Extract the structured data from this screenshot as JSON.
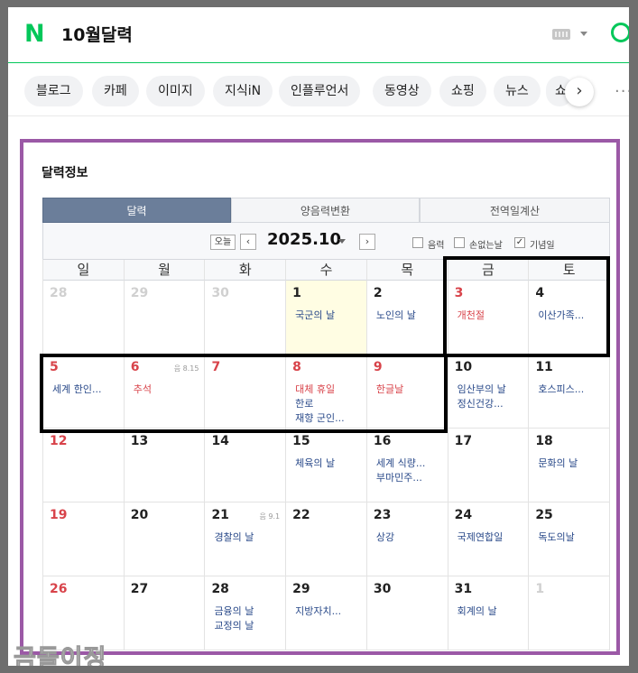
{
  "header": {
    "query": "10월달력",
    "logo": "N"
  },
  "tabs": [
    "블로그",
    "카페",
    "이미지",
    "지식iN",
    "인플루언서",
    "동영상",
    "쇼핑",
    "뉴스",
    "쇼"
  ],
  "section": {
    "title": "달력정보"
  },
  "segments": [
    "달력",
    "양음력변환",
    "전역일계산"
  ],
  "nav": {
    "today": "오늘",
    "prev": "‹",
    "next": "›",
    "year_month": "2025.10"
  },
  "options": [
    {
      "label": "음력",
      "checked": false
    },
    {
      "label": "손없는날",
      "checked": false
    },
    {
      "label": "기념일",
      "checked": true
    }
  ],
  "weekdays": [
    "일",
    "월",
    "화",
    "수",
    "목",
    "금",
    "토"
  ],
  "weeks": [
    [
      {
        "day": "28",
        "style": "dim",
        "events": []
      },
      {
        "day": "29",
        "style": "dim",
        "events": []
      },
      {
        "day": "30",
        "style": "dim",
        "events": []
      },
      {
        "day": "1",
        "style": "normal",
        "today": true,
        "events": [
          {
            "text": "국군의 날",
            "red": false
          }
        ]
      },
      {
        "day": "2",
        "style": "normal",
        "events": [
          {
            "text": "노인의 날",
            "red": false
          }
        ]
      },
      {
        "day": "3",
        "style": "red",
        "events": [
          {
            "text": "개천절",
            "red": true
          }
        ]
      },
      {
        "day": "4",
        "style": "normal",
        "events": [
          {
            "text": "이산가족...",
            "red": false
          }
        ]
      }
    ],
    [
      {
        "day": "5",
        "style": "red",
        "events": [
          {
            "text": "세계 한인...",
            "red": false
          }
        ]
      },
      {
        "day": "6",
        "style": "red",
        "lunar": "음 8.15",
        "events": [
          {
            "text": "추석",
            "red": true
          }
        ]
      },
      {
        "day": "7",
        "style": "red",
        "events": []
      },
      {
        "day": "8",
        "style": "red",
        "events": [
          {
            "text": "대체 휴일",
            "red": true
          },
          {
            "text": "한로",
            "red": false
          },
          {
            "text": "재향 군인...",
            "red": false
          }
        ]
      },
      {
        "day": "9",
        "style": "red",
        "events": [
          {
            "text": "한글날",
            "red": true
          }
        ]
      },
      {
        "day": "10",
        "style": "normal",
        "events": [
          {
            "text": "임산부의 날",
            "red": false
          },
          {
            "text": "정신건강...",
            "red": false
          }
        ]
      },
      {
        "day": "11",
        "style": "normal",
        "events": [
          {
            "text": "호스피스...",
            "red": false
          }
        ]
      }
    ],
    [
      {
        "day": "12",
        "style": "red",
        "events": []
      },
      {
        "day": "13",
        "style": "normal",
        "events": []
      },
      {
        "day": "14",
        "style": "normal",
        "events": []
      },
      {
        "day": "15",
        "style": "normal",
        "events": [
          {
            "text": "체육의 날",
            "red": false
          }
        ]
      },
      {
        "day": "16",
        "style": "normal",
        "events": [
          {
            "text": "세계 식량...",
            "red": false
          },
          {
            "text": "부마민주...",
            "red": false
          }
        ]
      },
      {
        "day": "17",
        "style": "normal",
        "events": []
      },
      {
        "day": "18",
        "style": "normal",
        "events": [
          {
            "text": "문화의 날",
            "red": false
          }
        ]
      }
    ],
    [
      {
        "day": "19",
        "style": "red",
        "events": []
      },
      {
        "day": "20",
        "style": "normal",
        "events": []
      },
      {
        "day": "21",
        "style": "normal",
        "lunar": "음 9.1",
        "events": [
          {
            "text": "경찰의 날",
            "red": false
          }
        ]
      },
      {
        "day": "22",
        "style": "normal",
        "events": []
      },
      {
        "day": "23",
        "style": "normal",
        "events": [
          {
            "text": "상강",
            "red": false
          }
        ]
      },
      {
        "day": "24",
        "style": "normal",
        "events": [
          {
            "text": "국제연합일",
            "red": false
          }
        ]
      },
      {
        "day": "25",
        "style": "normal",
        "events": [
          {
            "text": "독도의날",
            "red": false
          }
        ]
      }
    ],
    [
      {
        "day": "26",
        "style": "red",
        "events": []
      },
      {
        "day": "27",
        "style": "normal",
        "events": []
      },
      {
        "day": "28",
        "style": "normal",
        "events": [
          {
            "text": "금융의 날",
            "red": false
          },
          {
            "text": "교정의 날",
            "red": false
          }
        ]
      },
      {
        "day": "29",
        "style": "normal",
        "events": [
          {
            "text": "지방자치...",
            "red": false
          }
        ]
      },
      {
        "day": "30",
        "style": "normal",
        "events": []
      },
      {
        "day": "31",
        "style": "normal",
        "events": [
          {
            "text": "회계의 날",
            "red": false
          }
        ]
      },
      {
        "day": "1",
        "style": "dim",
        "events": []
      }
    ]
  ],
  "watermark": "금돌이정",
  "colors": {
    "brand": "#03c75a",
    "holiday": "#d8434a",
    "event": "#2a4a8a",
    "frame": "#9b59a6",
    "today_bg": "#fffde3"
  }
}
